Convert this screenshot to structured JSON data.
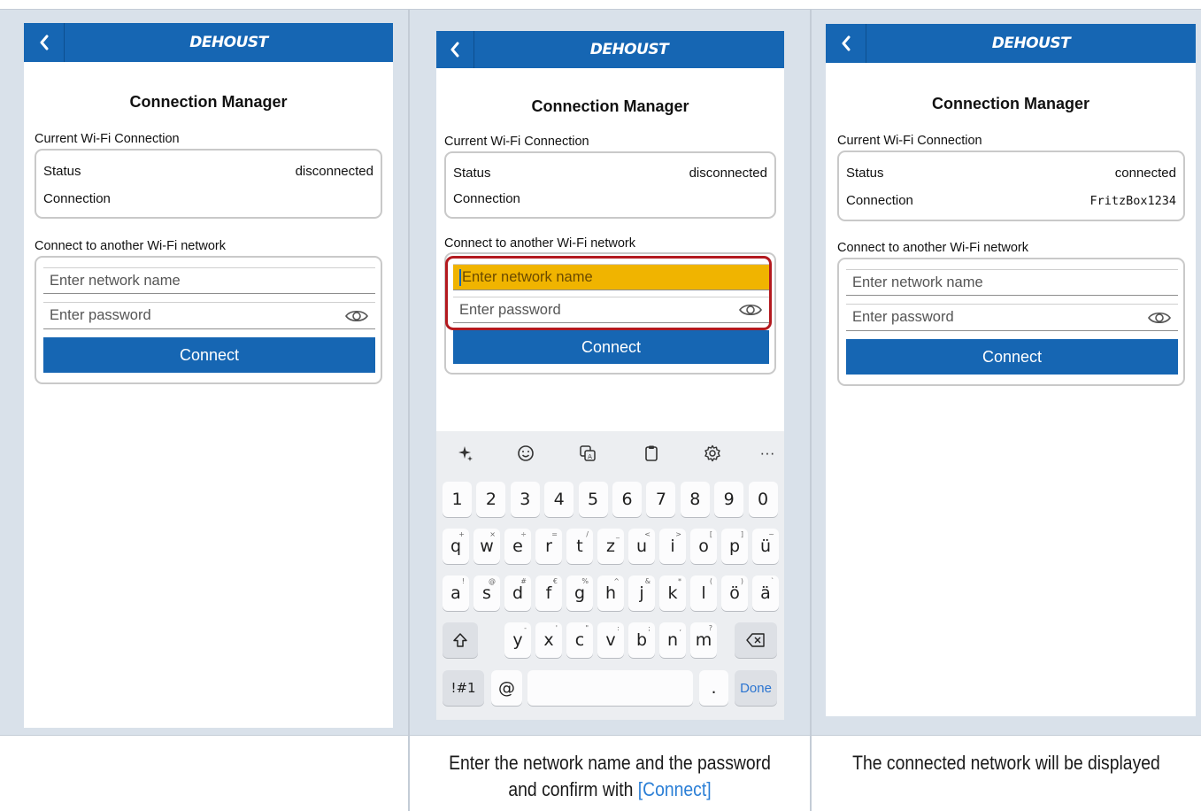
{
  "app": {
    "brand": "DEHOUST",
    "screen_title": "Connection Manager",
    "current_section_label": "Current Wi-Fi Connection",
    "connect_section_label": "Connect to another Wi-Fi network",
    "status_label": "Status",
    "connection_label": "Connection",
    "network_placeholder": "Enter network name",
    "password_placeholder": "Enter password",
    "connect_button": "Connect"
  },
  "screens": [
    {
      "status_value": "disconnected",
      "connection_value": ""
    },
    {
      "status_value": "disconnected",
      "connection_value": ""
    },
    {
      "status_value": "connected",
      "connection_value": "FritzBox1234"
    }
  ],
  "keyboard": {
    "toolbar_icons": [
      "sparkle-icon",
      "emoji-icon",
      "translate-icon",
      "clipboard-icon",
      "settings-icon",
      "more-icon"
    ],
    "more_label": "···",
    "row_numbers": [
      "1",
      "2",
      "3",
      "4",
      "5",
      "6",
      "7",
      "8",
      "9",
      "0"
    ],
    "row_top": [
      {
        "k": "q",
        "h": "+"
      },
      {
        "k": "w",
        "h": "×"
      },
      {
        "k": "e",
        "h": "÷"
      },
      {
        "k": "r",
        "h": "="
      },
      {
        "k": "t",
        "h": "/"
      },
      {
        "k": "z",
        "h": "_"
      },
      {
        "k": "u",
        "h": "<"
      },
      {
        "k": "i",
        "h": ">"
      },
      {
        "k": "o",
        "h": "["
      },
      {
        "k": "p",
        "h": "]"
      },
      {
        "k": "ü",
        "h": "~"
      }
    ],
    "row_mid": [
      {
        "k": "a",
        "h": "!"
      },
      {
        "k": "s",
        "h": "@"
      },
      {
        "k": "d",
        "h": "#"
      },
      {
        "k": "f",
        "h": "€"
      },
      {
        "k": "g",
        "h": "%"
      },
      {
        "k": "h",
        "h": "^"
      },
      {
        "k": "j",
        "h": "&"
      },
      {
        "k": "k",
        "h": "*"
      },
      {
        "k": "l",
        "h": "("
      },
      {
        "k": "ö",
        "h": ")"
      },
      {
        "k": "ä",
        "h": "`"
      }
    ],
    "row_bottom": [
      {
        "k": "y",
        "h": "-"
      },
      {
        "k": "x",
        "h": "'"
      },
      {
        "k": "c",
        "h": "\""
      },
      {
        "k": "v",
        "h": ":"
      },
      {
        "k": "b",
        "h": ";"
      },
      {
        "k": "n",
        "h": ","
      },
      {
        "k": "m",
        "h": "?"
      }
    ],
    "symbols_key": "!#1",
    "at_key": "@",
    "period_key": ".",
    "done_key": "Done"
  },
  "captions": {
    "step2_line1": "Enter the network name and the password",
    "step2_line2_prefix": "and confirm with ",
    "step2_link": "[Connect]",
    "step3": "The connected network will be displayed"
  }
}
